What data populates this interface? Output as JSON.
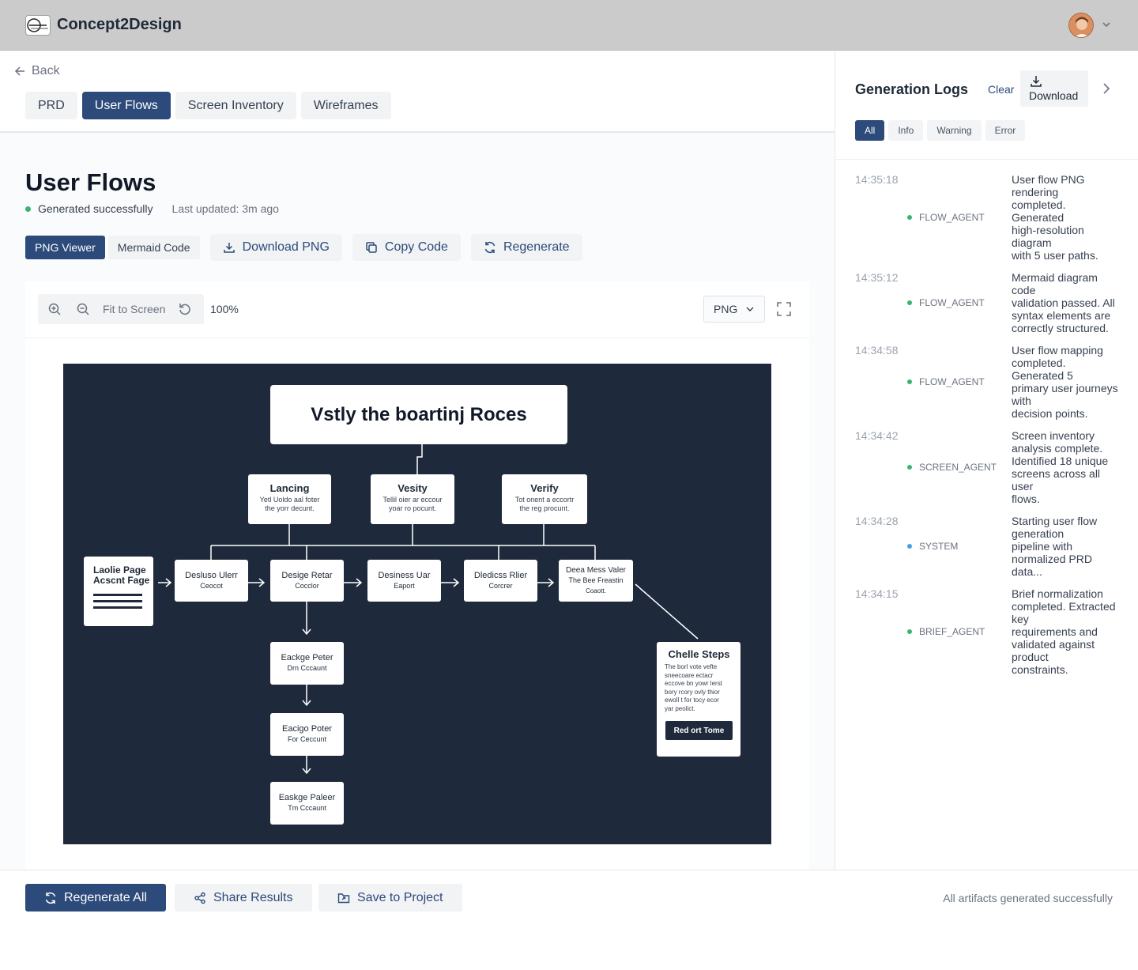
{
  "app": {
    "title": "Concept2Design"
  },
  "nav": {
    "back_label": "Back"
  },
  "tabs": [
    {
      "label": "PRD"
    },
    {
      "label": "User Flows"
    },
    {
      "label": "Screen Inventory"
    },
    {
      "label": "Wireframes"
    }
  ],
  "page": {
    "title": "User Flows",
    "status": "Generated successfully",
    "updated": "Last updated: 3m ago"
  },
  "view_modes": {
    "png": "PNG Viewer",
    "mermaid": "Mermaid Code"
  },
  "actions": {
    "download": "Download PNG",
    "copy": "Copy Code",
    "regenerate": "Regenerate"
  },
  "viewer": {
    "fit_label": "Fit to Screen",
    "zoom": "100%",
    "format": "PNG"
  },
  "diagram": {
    "title": "Vstly the boartinj Roces",
    "top_nodes": [
      {
        "title": "Lancing",
        "sub1": "Yetl Uoldo aal foter",
        "sub2": "the yorr decunt."
      },
      {
        "title": "Vesity",
        "sub1": "Tellil oier ar eccour",
        "sub2": "yoar ro pocunt."
      },
      {
        "title": "Verify",
        "sub1": "Tot onent a eccortr",
        "sub2": "the reg procunt."
      }
    ],
    "landing_node": {
      "line1": "Laolie Page",
      "line2": "Acscnt Fage"
    },
    "row_nodes": [
      {
        "line1": "Desluso Ulerr",
        "line2": "Ceocot",
        "line3": ""
      },
      {
        "line1": "Desige Retar",
        "line2": "Cocclor",
        "line3": ""
      },
      {
        "line1": "Desiness Uar",
        "line2": "Eaport",
        "line3": ""
      },
      {
        "line1": "Dledicss Rlier",
        "line2": "Corcrer",
        "line3": ""
      },
      {
        "line1": "Deea Mess Valer",
        "line2": "The Bee Freastin",
        "line3": "Coaott."
      }
    ],
    "column_nodes": [
      {
        "line1": "Eackge Peter",
        "line2": "Drn Cccaunt"
      },
      {
        "line1": "Eacigo Poter",
        "line2": "For Ceccunt"
      },
      {
        "line1": "Easkge Paleer",
        "line2": "Tm Cccaunt"
      }
    ],
    "side_node": {
      "title": "Chelle Steps",
      "body": [
        "The borl vote vefte",
        "sneecoare ectacr",
        "eccove bn yowr lerst",
        "bory rcory ovly thior",
        "ewoll t for tocy ecor",
        "yar peolict."
      ],
      "button": "Red ort Tome"
    }
  },
  "bottom": {
    "regenerate_all": "Regenerate All",
    "share": "Share Results",
    "save": "Save to Project",
    "status": "All artifacts generated successfully"
  },
  "logs": {
    "title": "Generation Logs",
    "clear": "Clear",
    "download": "Download",
    "filters": [
      "All",
      "Info",
      "Warning",
      "Error"
    ],
    "entries": [
      {
        "time": "14:35:18",
        "agent": "FLOW_AGENT",
        "dot_color": "#3cb371",
        "lines": [
          "User flow PNG",
          "rendering",
          "completed.",
          "Generated",
          "high-resolution",
          "diagram",
          "with 5 user paths."
        ]
      },
      {
        "time": "14:35:12",
        "agent": "FLOW_AGENT",
        "dot_color": "#3cb371",
        "lines": [
          "Mermaid diagram",
          "code",
          "validation passed. All",
          "syntax elements are",
          "correctly structured."
        ]
      },
      {
        "time": "14:34:58",
        "agent": "FLOW_AGENT",
        "dot_color": "#3cb371",
        "lines": [
          "User flow mapping",
          "completed.",
          "Generated 5",
          "primary user journeys",
          "with",
          "decision points."
        ]
      },
      {
        "time": "14:34:42",
        "agent": "SCREEN_AGENT",
        "dot_color": "#3cb371",
        "lines": [
          "Screen inventory",
          "analysis complete.",
          "Identified 18 unique",
          "screens across all",
          "user",
          "flows."
        ]
      },
      {
        "time": "14:34:28",
        "agent": "SYSTEM",
        "dot_color": "#4a9fe0",
        "lines": [
          "Starting user flow",
          "generation",
          "pipeline with",
          "normalized PRD",
          "data..."
        ]
      },
      {
        "time": "14:34:15",
        "agent": "BRIEF_AGENT",
        "dot_color": "#3cb371",
        "lines": [
          "Brief normalization",
          "completed. Extracted",
          "key",
          "requirements and",
          "validated against",
          "product",
          "constraints."
        ]
      }
    ]
  }
}
